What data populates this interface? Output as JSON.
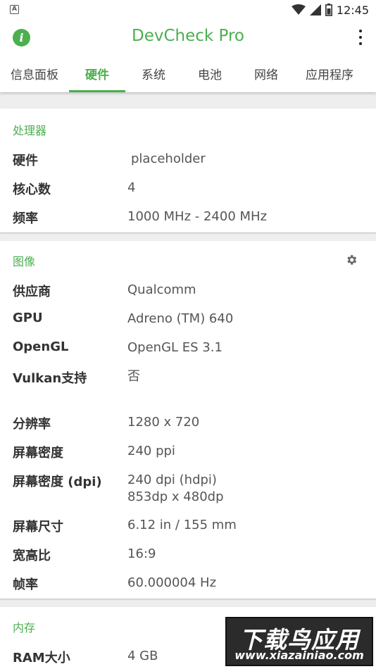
{
  "status_bar": {
    "notification_icon_letter": "A",
    "time": "12:45",
    "icons": [
      "wifi-icon",
      "signal-icon",
      "battery-icon"
    ]
  },
  "app_bar": {
    "title": "DevCheck Pro",
    "left_icon": "info-icon",
    "right_icon": "more-vert-icon",
    "accent_color": "#4caf50"
  },
  "tabs": [
    {
      "label": "信息面板",
      "active": false
    },
    {
      "label": "硬件",
      "active": true
    },
    {
      "label": "系统",
      "active": false
    },
    {
      "label": "电池",
      "active": false
    },
    {
      "label": "网络",
      "active": false
    },
    {
      "label": "应用程序",
      "active": false
    }
  ],
  "processor": {
    "title": "处理器",
    "rows": [
      {
        "label": "硬件",
        "value": "placeholder"
      },
      {
        "label": "核心数",
        "value": "4"
      },
      {
        "label": "频率",
        "value": "1000 MHz - 2400 MHz"
      }
    ]
  },
  "display": {
    "title": "图像",
    "settings_icon": "gear-icon",
    "rows": [
      {
        "label": "供应商",
        "value": "Qualcomm"
      },
      {
        "label": "GPU",
        "value": "Adreno (TM) 640"
      },
      {
        "label": "OpenGL",
        "value": "OpenGL ES 3.1"
      },
      {
        "label": "Vulkan支持",
        "value": "否"
      },
      {
        "label": "分辨率",
        "value": "1280 x 720"
      },
      {
        "label": "屏幕密度",
        "value": "240 ppi"
      },
      {
        "label": "屏幕密度 (dpi)",
        "value": "240 dpi (hdpi)",
        "value2": "853dp x 480dp"
      },
      {
        "label": "屏幕尺寸",
        "value": "6.12 in / 155 mm"
      },
      {
        "label": "宽高比",
        "value": "16:9"
      },
      {
        "label": "帧率",
        "value": "60.000004 Hz"
      }
    ]
  },
  "memory": {
    "title": "内存",
    "rows": [
      {
        "label": "RAM大小",
        "value": "4 GB"
      }
    ]
  },
  "watermark": {
    "main": "下载鸟应用",
    "sub": "www.xiazainiao.com"
  }
}
